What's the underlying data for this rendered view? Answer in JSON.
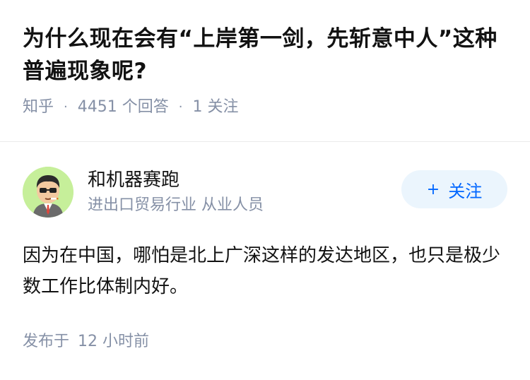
{
  "question": {
    "title": "为什么现在会有“上岸第一剑，先斩意中人”这种普遍现象呢?",
    "source": "知乎",
    "separator": "·",
    "answer_count": "4451 个回答",
    "follow_count": "1 关注"
  },
  "answer": {
    "author": {
      "name": "和机器赛跑",
      "headline": "进出口贸易行业 从业人员",
      "avatar_icon": "cartoon-avatar-icon"
    },
    "follow_button": {
      "icon": "+",
      "label": "关注"
    },
    "content": "因为在中国，哪怕是北上广深这样的发达地区，也只是极少数工作比体制内好。",
    "published_label": "发布于",
    "published_time": "12 小时前"
  },
  "colors": {
    "title": "#121212",
    "meta": "#8590a6",
    "accent": "#0066ff",
    "follow_bg": "#ebf5fd",
    "avatar_bg": "#c6ef9a"
  }
}
